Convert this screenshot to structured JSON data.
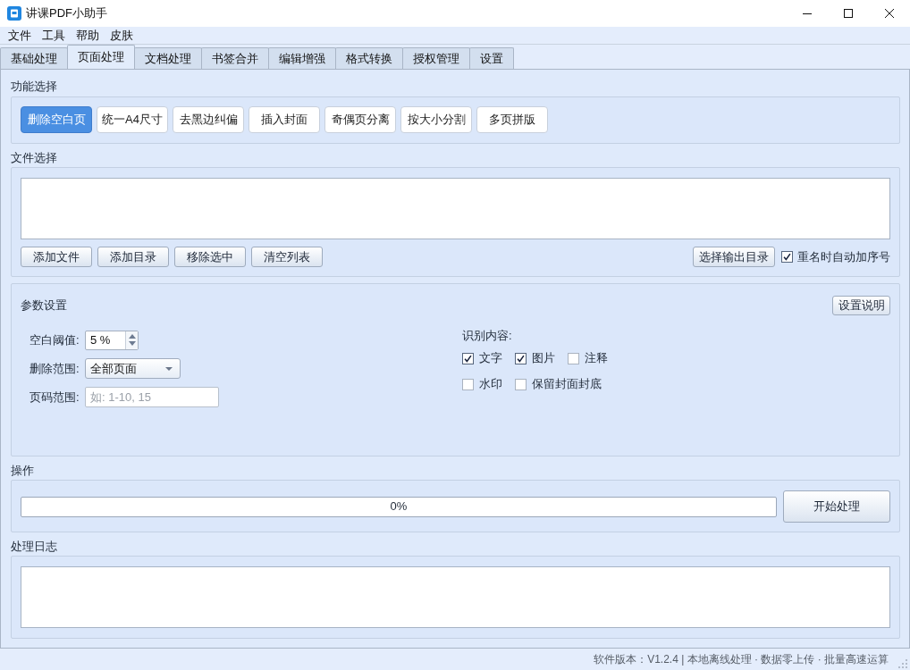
{
  "window": {
    "title": "讲课PDF小助手"
  },
  "menu": [
    "文件",
    "工具",
    "帮助",
    "皮肤"
  ],
  "tabs": [
    {
      "label": "基础处理",
      "selected": false
    },
    {
      "label": "页面处理",
      "selected": true
    },
    {
      "label": "文档处理",
      "selected": false
    },
    {
      "label": "书签合并",
      "selected": false
    },
    {
      "label": "编辑增强",
      "selected": false
    },
    {
      "label": "格式转换",
      "selected": false
    },
    {
      "label": "授权管理",
      "selected": false
    },
    {
      "label": "设置",
      "selected": false
    }
  ],
  "function_select": {
    "label": "功能选择",
    "buttons": [
      {
        "label": "删除空白页",
        "selected": true
      },
      {
        "label": "统一A4尺寸",
        "selected": false
      },
      {
        "label": "去黑边纠偏",
        "selected": false
      },
      {
        "label": "插入封面",
        "selected": false
      },
      {
        "label": "奇偶页分离",
        "selected": false
      },
      {
        "label": "按大小分割",
        "selected": false
      },
      {
        "label": "多页拼版",
        "selected": false
      }
    ]
  },
  "file_select": {
    "label": "文件选择",
    "buttons": [
      "添加文件",
      "添加目录",
      "移除选中",
      "清空列表"
    ],
    "output_button": "选择输出目录",
    "auto_number": {
      "label": "重名时自动加序号",
      "checked": true
    }
  },
  "parameters": {
    "title": "参数设置",
    "help_button": "设置说明",
    "fields": [
      {
        "kind": "spin",
        "label": "空白阈值:",
        "value": "5 %"
      },
      {
        "kind": "select",
        "label": "删除范围:",
        "value": "全部页面"
      },
      {
        "kind": "text",
        "label": "页码范围:",
        "placeholder": "如: 1-10, 15"
      }
    ],
    "recognize": {
      "label": "识别内容:",
      "rows": [
        {
          "options": [
            {
              "label": "文字",
              "checked": true
            },
            {
              "label": "图片",
              "checked": true
            },
            {
              "label": "注释",
              "checked": false
            }
          ]
        },
        {
          "options": [
            {
              "label": "水印",
              "checked": false
            },
            {
              "label": "保留封面封底",
              "checked": false
            }
          ]
        }
      ]
    }
  },
  "operation": {
    "label": "操作",
    "progress": {
      "level": 0,
      "reading": "0%"
    },
    "start_button": "开始处理"
  },
  "log": {
    "label": "处理日志"
  },
  "status_bar": "软件版本：V1.2.4 | 本地离线处理 · 数据零上传 · 批量高速运算"
}
